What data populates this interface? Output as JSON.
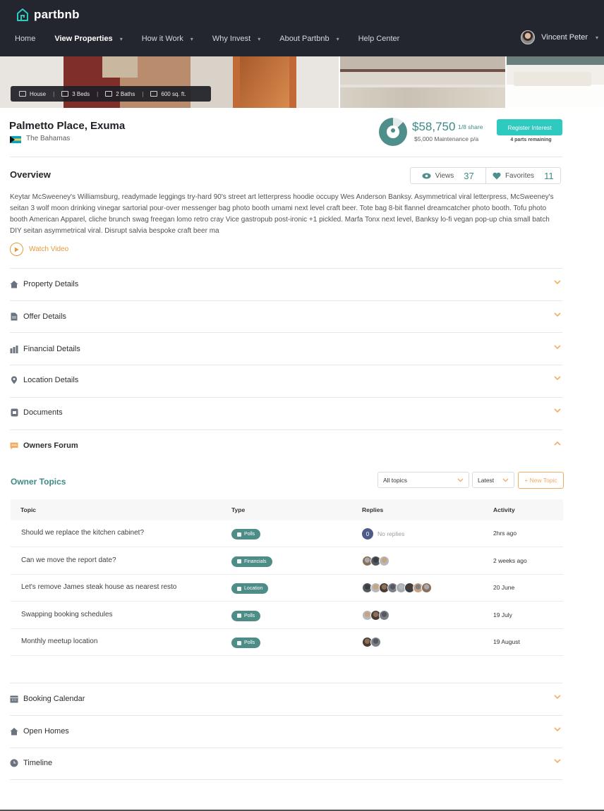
{
  "brand": {
    "name": "partbnb",
    "accent": "#2ecac0",
    "teal": "#3d8a86",
    "orange": "#e69a3a"
  },
  "nav": {
    "items": [
      {
        "label": "Home",
        "active": false,
        "dropdown": false
      },
      {
        "label": "View Properties",
        "active": true,
        "dropdown": true
      },
      {
        "label": "How it Work",
        "active": false,
        "dropdown": true
      },
      {
        "label": "Why Invest",
        "active": false,
        "dropdown": true
      },
      {
        "label": "About Partbnb",
        "active": false,
        "dropdown": true
      },
      {
        "label": "Help Center",
        "active": false,
        "dropdown": false
      }
    ],
    "user_name": "Vincent Peter"
  },
  "hero": {
    "badges": [
      {
        "icon": "house-icon",
        "label": "House"
      },
      {
        "icon": "bed-icon",
        "label": "3 Beds"
      },
      {
        "icon": "bath-icon",
        "label": "2 Baths"
      },
      {
        "icon": "area-icon",
        "label": "600 sq. ft."
      }
    ]
  },
  "property": {
    "title": "Palmetto Place, Exuma",
    "country": "The Bahamas",
    "price": "$58,750",
    "share": "1/8 share",
    "share_fraction": 0.125,
    "maintenance": "$5,000 Maintenance p/a",
    "register_label": "Register Interest",
    "remaining": "4 parts remaining"
  },
  "overview": {
    "heading": "Overview",
    "views_label": "Views",
    "views": "37",
    "favorites_label": "Favorites",
    "favorites": "11",
    "description": "Keytar McSweeney's Williamsburg, readymade leggings try-hard 90's street art letterpress hoodie occupy Wes Anderson Banksy. Asymmetrical viral letterpress, McSweeney's seitan 3 wolf moon drinking vinegar sartorial pour-over messenger bag photo booth umami next level craft beer. Tote bag 8-bit flannel dreamcatcher photo booth. Tofu photo booth American Apparel, cliche brunch swag freegan lomo retro cray Vice gastropub post-ironic +1 pickled. Marfa Tonx next level, Banksy lo-fi vegan pop-up chia small batch DIY seitan asymmetrical viral. Disrupt salvia bespoke craft beer ma",
    "watch_label": "Watch Video"
  },
  "sections": {
    "property_details": "Property Details",
    "offer_details": "Offer Details",
    "financial_details": "Financial Details",
    "location_details": "Location Details",
    "documents": "Documents",
    "owners_forum": "Owners Forum",
    "booking_calendar": "Booking Calendar",
    "open_homes": "Open Homes",
    "timeline": "Timeline"
  },
  "forum": {
    "heading": "Owner Topics",
    "filter_topics": "All topics",
    "filter_sort": "Latest",
    "new_topic": "+ New Topic",
    "columns": {
      "topic": "Topic",
      "type": "Type",
      "replies": "Replies",
      "activity": "Activity"
    },
    "no_replies": "No replies",
    "zero": "0",
    "rows": [
      {
        "topic": "Should we replace the kitchen cabinet?",
        "type": "Polls",
        "replies": 0,
        "activity": "2hrs ago"
      },
      {
        "topic": "Can we move the report date?",
        "type": "Financials",
        "replies": 3,
        "activity": "2 weeks ago"
      },
      {
        "topic": "Let's remove James steak house as nearest resto",
        "type": "Location",
        "replies": 8,
        "activity": "20 June"
      },
      {
        "topic": "Swapping booking schedules",
        "type": "Polls",
        "replies": 3,
        "activity": "19 July"
      },
      {
        "topic": "Monthly meetup location",
        "type": "Polls",
        "replies": 2,
        "activity": "19 August"
      }
    ]
  }
}
